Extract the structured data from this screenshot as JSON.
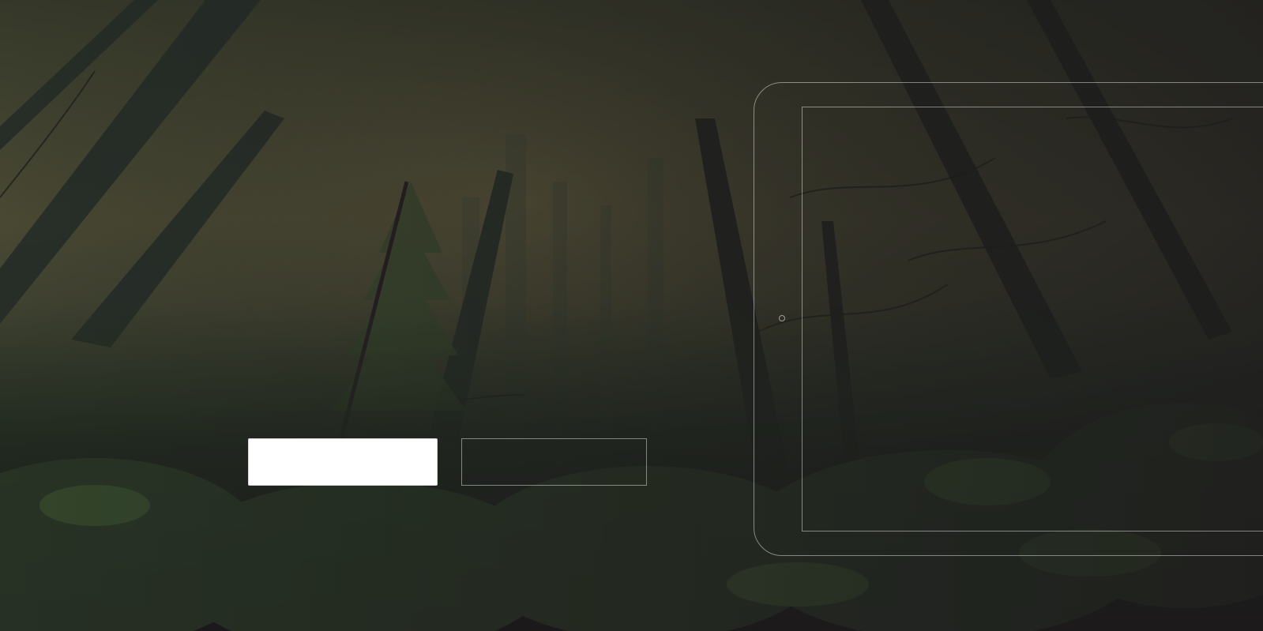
{
  "hero": {
    "primary_button_label": "",
    "secondary_button_label": ""
  },
  "device": {
    "screen_content": ""
  },
  "colors": {
    "background_dark": "#1d1a1d",
    "forest_haze": "#5d5a37",
    "foliage": "#3f5a31",
    "outline": "#cfd2c7"
  }
}
